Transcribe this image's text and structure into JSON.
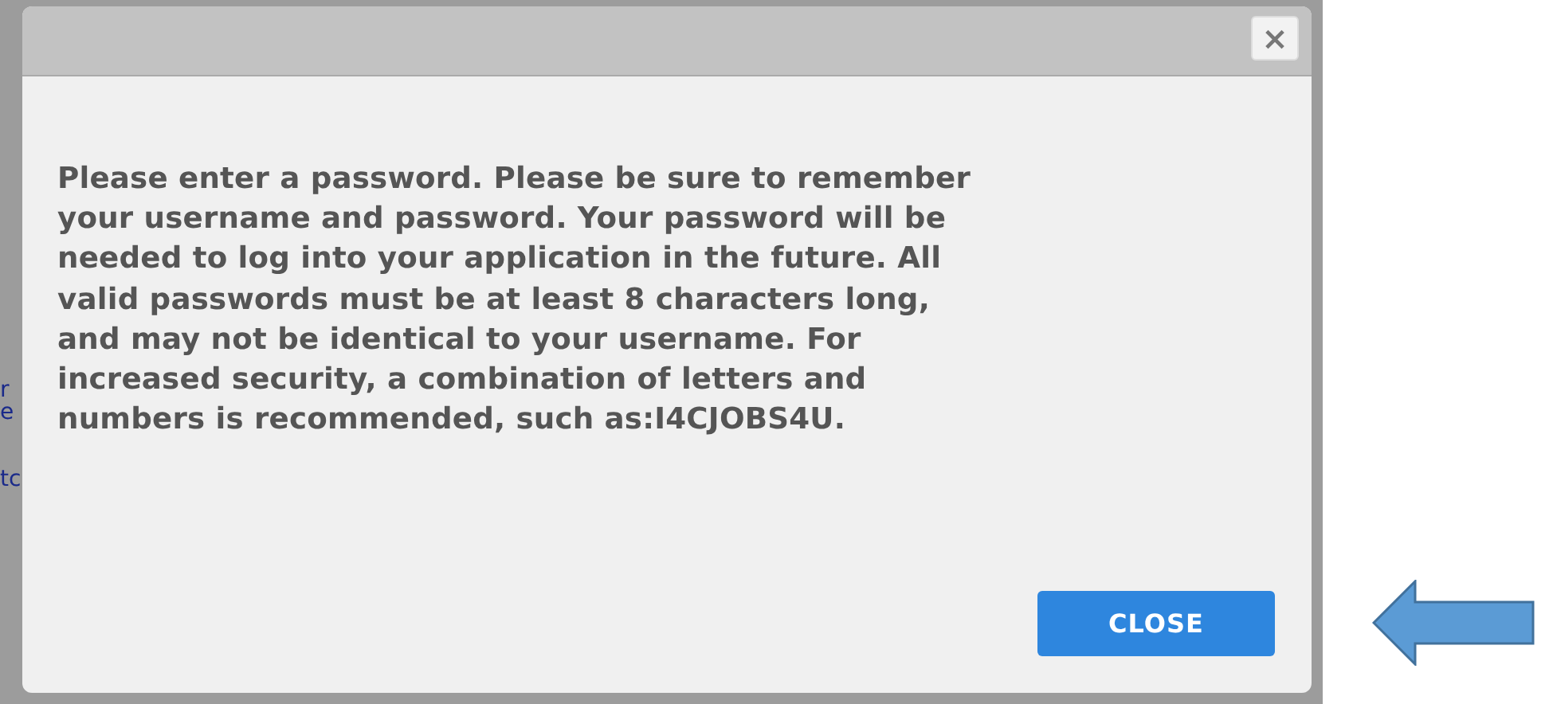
{
  "background_fragments": [
    "r",
    "e",
    "tc"
  ],
  "dialog": {
    "close_icon": "×",
    "message_lines": [
      "Please enter a password. Please be sure to remember",
      "your username and password. Your password will be",
      "needed to log into your application in the future. All",
      "valid passwords must be at least 8 characters long,",
      "and may not be identical to your username. For",
      "increased security, a combination of letters and",
      "numbers is recommended, such as:I4CJOBS4U."
    ],
    "button": "CLOSE"
  }
}
